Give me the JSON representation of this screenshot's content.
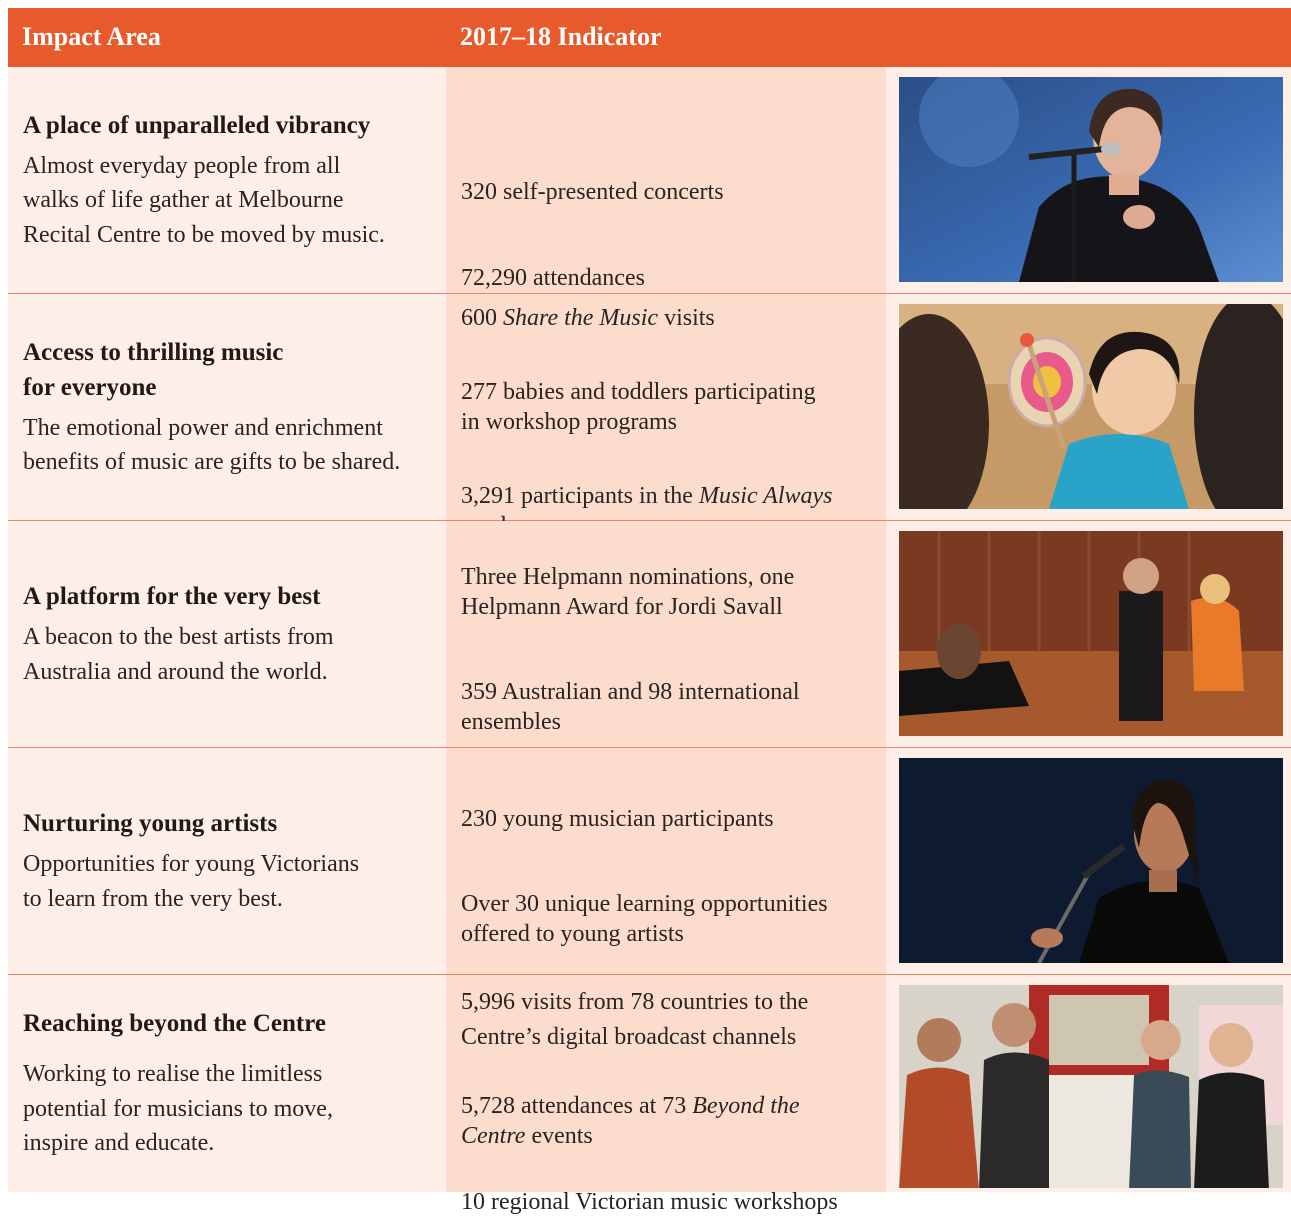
{
  "header": {
    "col1": "Impact Area",
    "col2": "2017–18 Indicator"
  },
  "rows": [
    {
      "title": "A place of unparalleled vibrancy",
      "desc": "Almost everyday people from all\nwalks of life gather at Melbourne\nRecital Centre to be moved by music.",
      "indicators": [
        [
          "320 self-presented concerts"
        ],
        [
          "72,290 attendances"
        ]
      ]
    },
    {
      "title": "Access to thrilling music\nfor everyone",
      "desc": "The emotional power and enrichment\nbenefits of music are gifts to be shared.",
      "indicators": [
        [
          "600 ",
          "Share the Music",
          " visits"
        ],
        [
          "277 babies and toddlers participating\nin workshop programs"
        ],
        [
          "3,291 participants in the ",
          "Music Always",
          "\naged care program"
        ]
      ]
    },
    {
      "title": "A platform for the very best",
      "desc": "A beacon to the best artists from\nAustralia and around the world.",
      "indicators": [
        [
          "Three Helpmann nominations, one\nHelpmann Award for Jordi Savall"
        ],
        [
          "359 Australian and 98 international\nensembles"
        ]
      ]
    },
    {
      "title": "Nurturing young artists",
      "desc": "Opportunities for young Victorians\nto learn from the very best.",
      "indicators": [
        [
          "230 young musician participants"
        ],
        [
          "Over 30 unique learning opportunities\noffered to young artists"
        ]
      ]
    },
    {
      "title": "Reaching beyond the Centre",
      "desc": "Working to realise the limitless\npotential for musicians to move,\ninspire and educate.",
      "indicators": [
        [
          "5,996 visits from 78 countries to the\nCentre’s digital broadcast channels"
        ],
        [
          "5,728 attendances at 73 ",
          "Beyond the\nCentre",
          " events"
        ],
        [
          "10 regional Victorian music workshops"
        ]
      ]
    }
  ],
  "colors": {
    "header": "#e65a2c",
    "col_light": "#fdeee7",
    "col_mid": "#fbdccd",
    "divider": "#e8876a"
  }
}
